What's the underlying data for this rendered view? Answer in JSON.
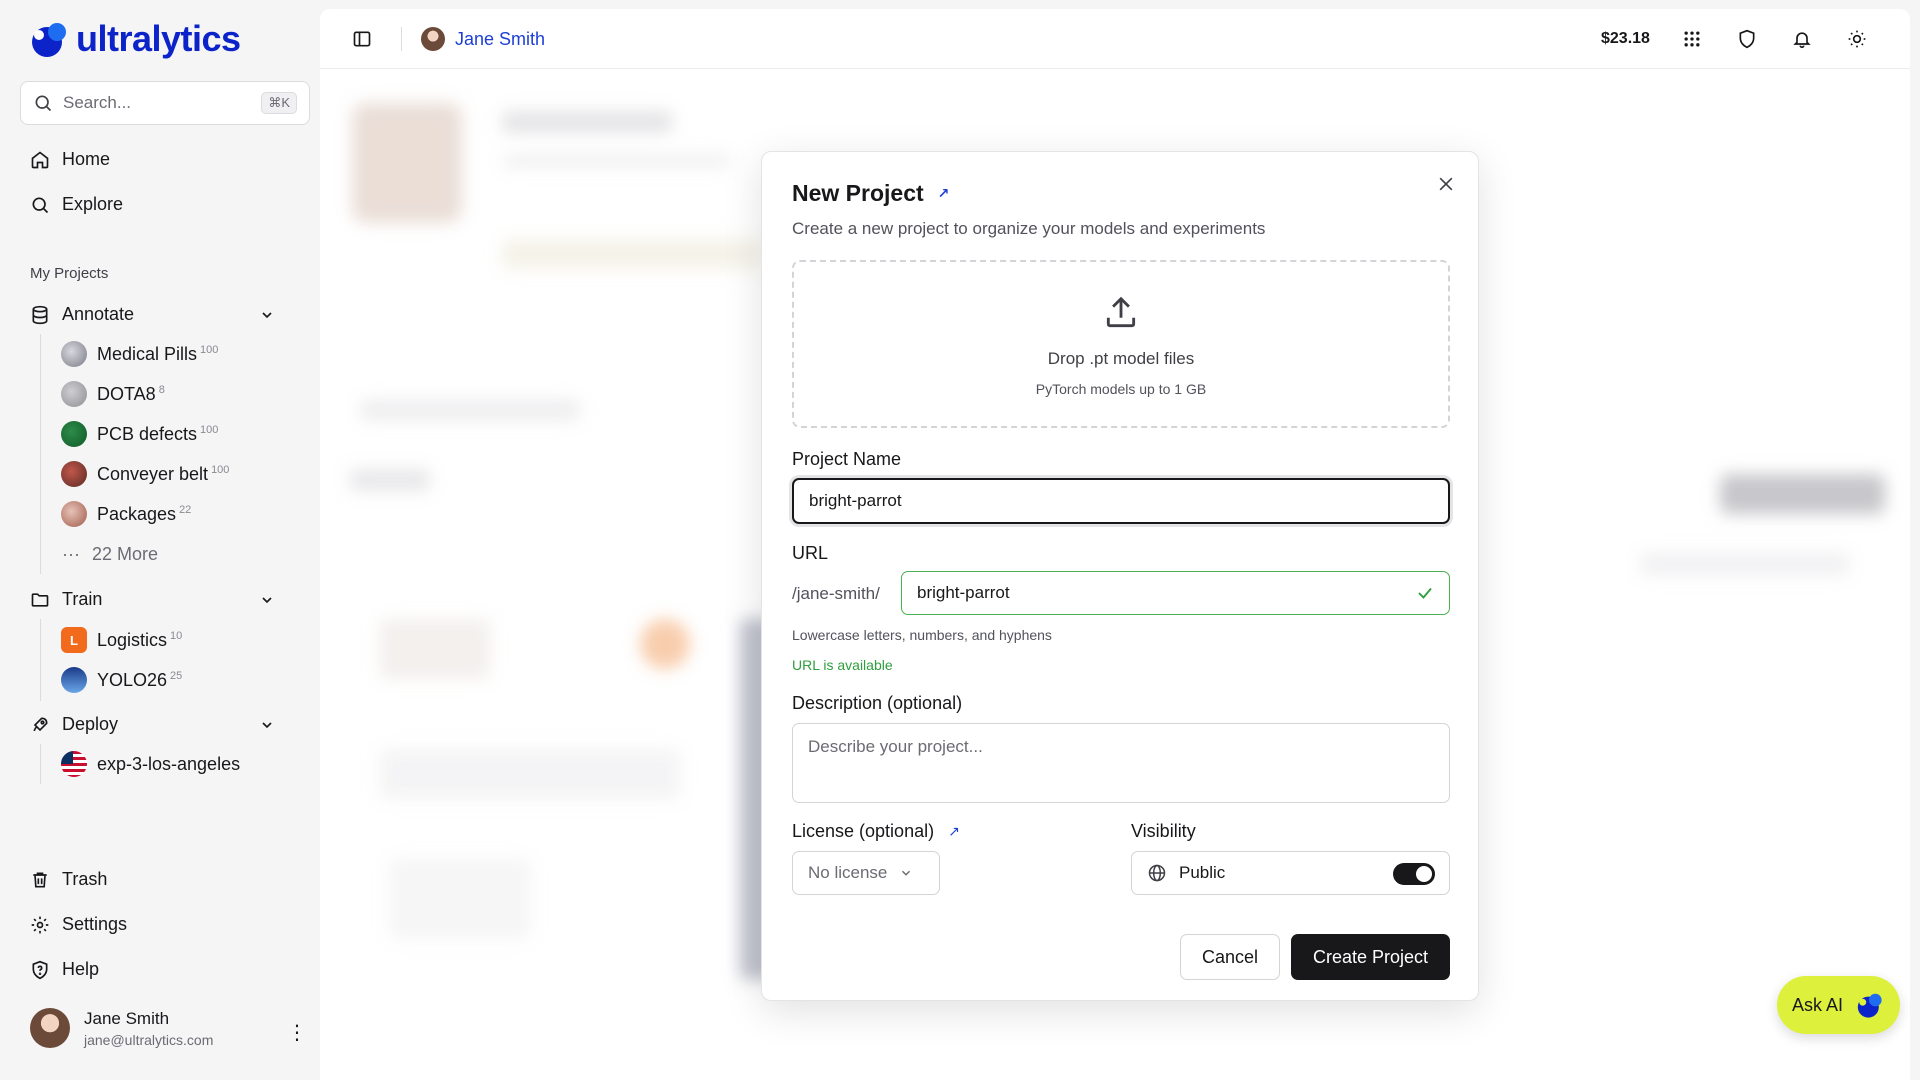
{
  "app": {
    "brand": "ultralytics"
  },
  "sidebar": {
    "search_placeholder": "Search...",
    "search_shortcut": "⌘K",
    "nav": [
      {
        "label": "Home"
      },
      {
        "label": "Explore"
      }
    ],
    "section_label": "My Projects",
    "groups": {
      "annotate": {
        "label": "Annotate",
        "items": [
          {
            "label": "Medical Pills",
            "count": "100"
          },
          {
            "label": "DOTA8",
            "count": "8"
          },
          {
            "label": "PCB defects",
            "count": "100"
          },
          {
            "label": "Conveyer belt",
            "count": "100"
          },
          {
            "label": "Packages",
            "count": "22"
          }
        ],
        "more": "22 More"
      },
      "train": {
        "label": "Train",
        "items": [
          {
            "label": "Logistics",
            "count": "10",
            "initial": "L"
          },
          {
            "label": "YOLO26",
            "count": "25"
          }
        ]
      },
      "deploy": {
        "label": "Deploy",
        "items": [
          {
            "label": "exp-3-los-angeles"
          }
        ]
      }
    },
    "bottom": [
      {
        "label": "Trash"
      },
      {
        "label": "Settings"
      },
      {
        "label": "Help"
      }
    ],
    "user": {
      "name": "Jane Smith",
      "email": "jane@ultralytics.com"
    }
  },
  "topbar": {
    "user_name": "Jane Smith",
    "credit": "$23.18"
  },
  "modal": {
    "title": "New Project",
    "subtitle": "Create a new project to organize your models and experiments",
    "drop_title": "Drop .pt model files",
    "drop_sub": "PyTorch models up to 1 GB",
    "project_name_label": "Project Name",
    "project_name_value": "bright-parrot",
    "url_label": "URL",
    "url_prefix": "/jane-smith/",
    "url_value": "bright-parrot",
    "url_hint": "Lowercase letters, numbers, and hyphens",
    "url_status": "URL is available",
    "description_label": "Description (optional)",
    "description_placeholder": "Describe your project...",
    "license_label": "License (optional)",
    "license_value": "No license",
    "visibility_label": "Visibility",
    "visibility_value": "Public",
    "cancel_label": "Cancel",
    "create_label": "Create Project"
  },
  "ask_ai": {
    "label": "Ask AI"
  },
  "colors": {
    "brand": "#0b23c9",
    "accent": "#1d3fd6",
    "ask_ai_bg": "#dcf03c",
    "success": "#2e9e3e"
  }
}
